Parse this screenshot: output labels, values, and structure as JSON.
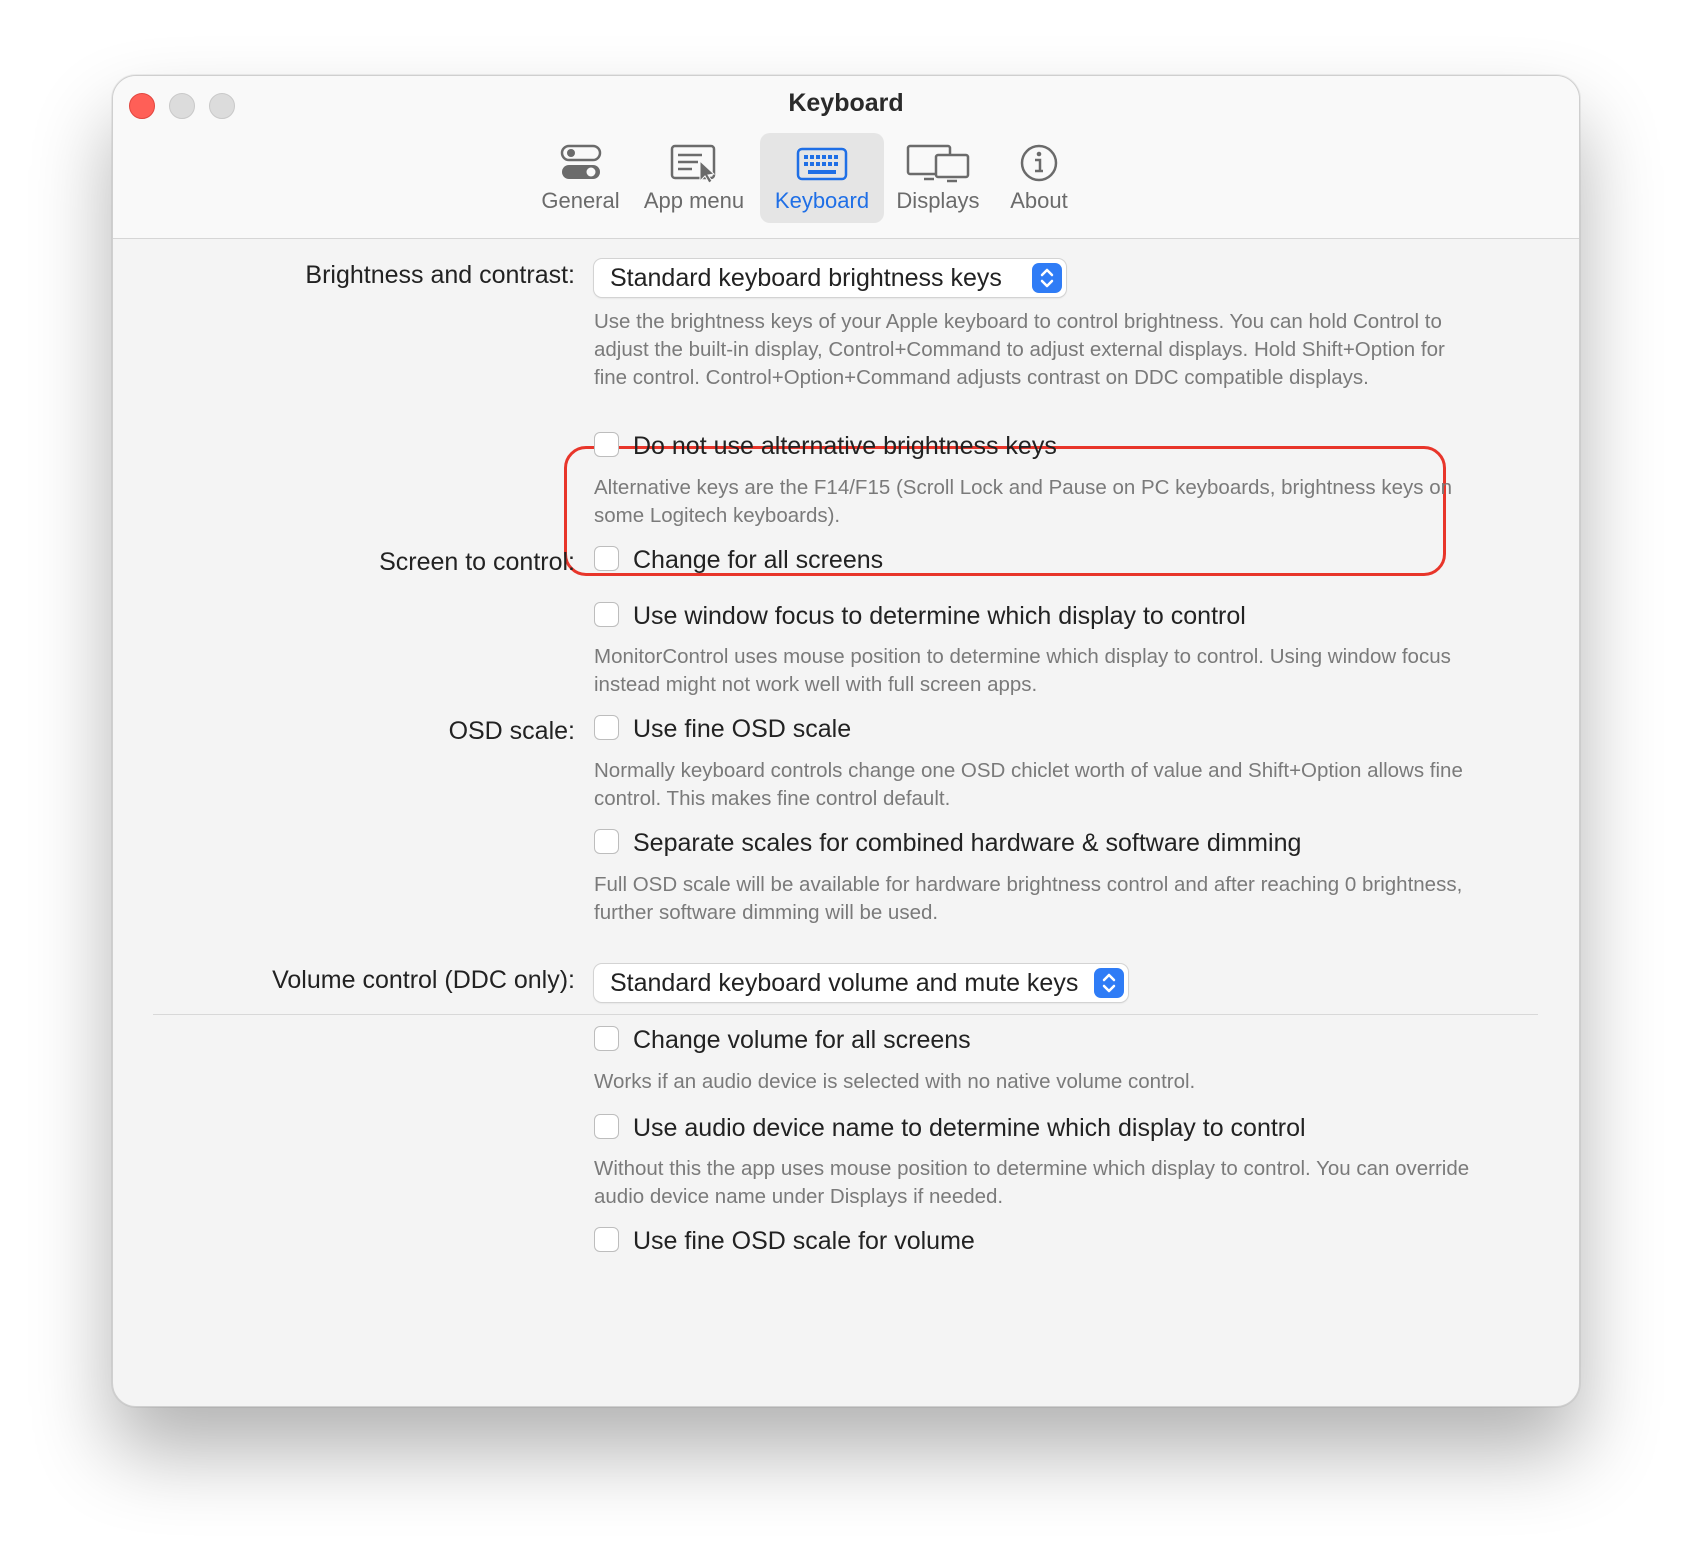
{
  "window": {
    "title": "Keyboard"
  },
  "tabs": [
    {
      "label": "General",
      "icon": "toggle-switches-icon",
      "active": false
    },
    {
      "label": "App menu",
      "icon": "menu-cursor-icon",
      "active": false
    },
    {
      "label": "Keyboard",
      "icon": "keyboard-icon",
      "active": true
    },
    {
      "label": "Displays",
      "icon": "displays-icon",
      "active": false
    },
    {
      "label": "About",
      "icon": "info-icon",
      "active": false
    }
  ],
  "brightness": {
    "label": "Brightness and contrast:",
    "selected": "Standard keyboard brightness keys",
    "description": "Use the brightness keys of your Apple keyboard to control brightness. You can hold Control to adjust the built-in display, Control+Command to adjust external displays. Hold Shift+Option for fine control. Control+Option+Command adjusts contrast on DDC compatible displays.",
    "alt_keys": {
      "label": "Do not use alternative brightness keys",
      "checked": false,
      "description": "Alternative keys are the F14/F15 (Scroll Lock and Pause on PC keyboards, brightness keys on some Logitech keyboards)."
    }
  },
  "screen_control": {
    "label": "Screen to control:",
    "all_screens": {
      "label": "Change for all screens",
      "checked": false
    },
    "window_focus": {
      "label": "Use window focus to determine which display to control",
      "checked": false,
      "description": "MonitorControl uses mouse position to determine which display to control. Using window focus instead might not work well with full screen apps."
    }
  },
  "osd": {
    "label": "OSD scale:",
    "fine": {
      "label": "Use fine OSD scale",
      "checked": false,
      "description": "Normally keyboard controls change one OSD chiclet worth of value and Shift+Option allows fine control. This makes fine control default."
    },
    "separate": {
      "label": "Separate scales for combined hardware & software dimming",
      "checked": false,
      "description": "Full OSD scale will be available for hardware brightness control and after reaching 0 brightness, further software dimming will be used."
    }
  },
  "volume": {
    "label": "Volume control (DDC only):",
    "selected": "Standard keyboard volume and mute keys",
    "all_screens": {
      "label": "Change volume for all screens",
      "checked": false,
      "description": "Works if an audio device is selected with no native volume control."
    },
    "audio_name": {
      "label": "Use audio device name to determine which display to control",
      "checked": false,
      "description": "Without this the app uses mouse position to determine which display to control. You can override audio device name under Displays if needed."
    },
    "fine": {
      "label": "Use fine OSD scale for volume",
      "checked": false
    }
  },
  "colors": {
    "accent": "#2f7cf6",
    "highlight": "#e8352a",
    "close": "#ff5f57"
  }
}
